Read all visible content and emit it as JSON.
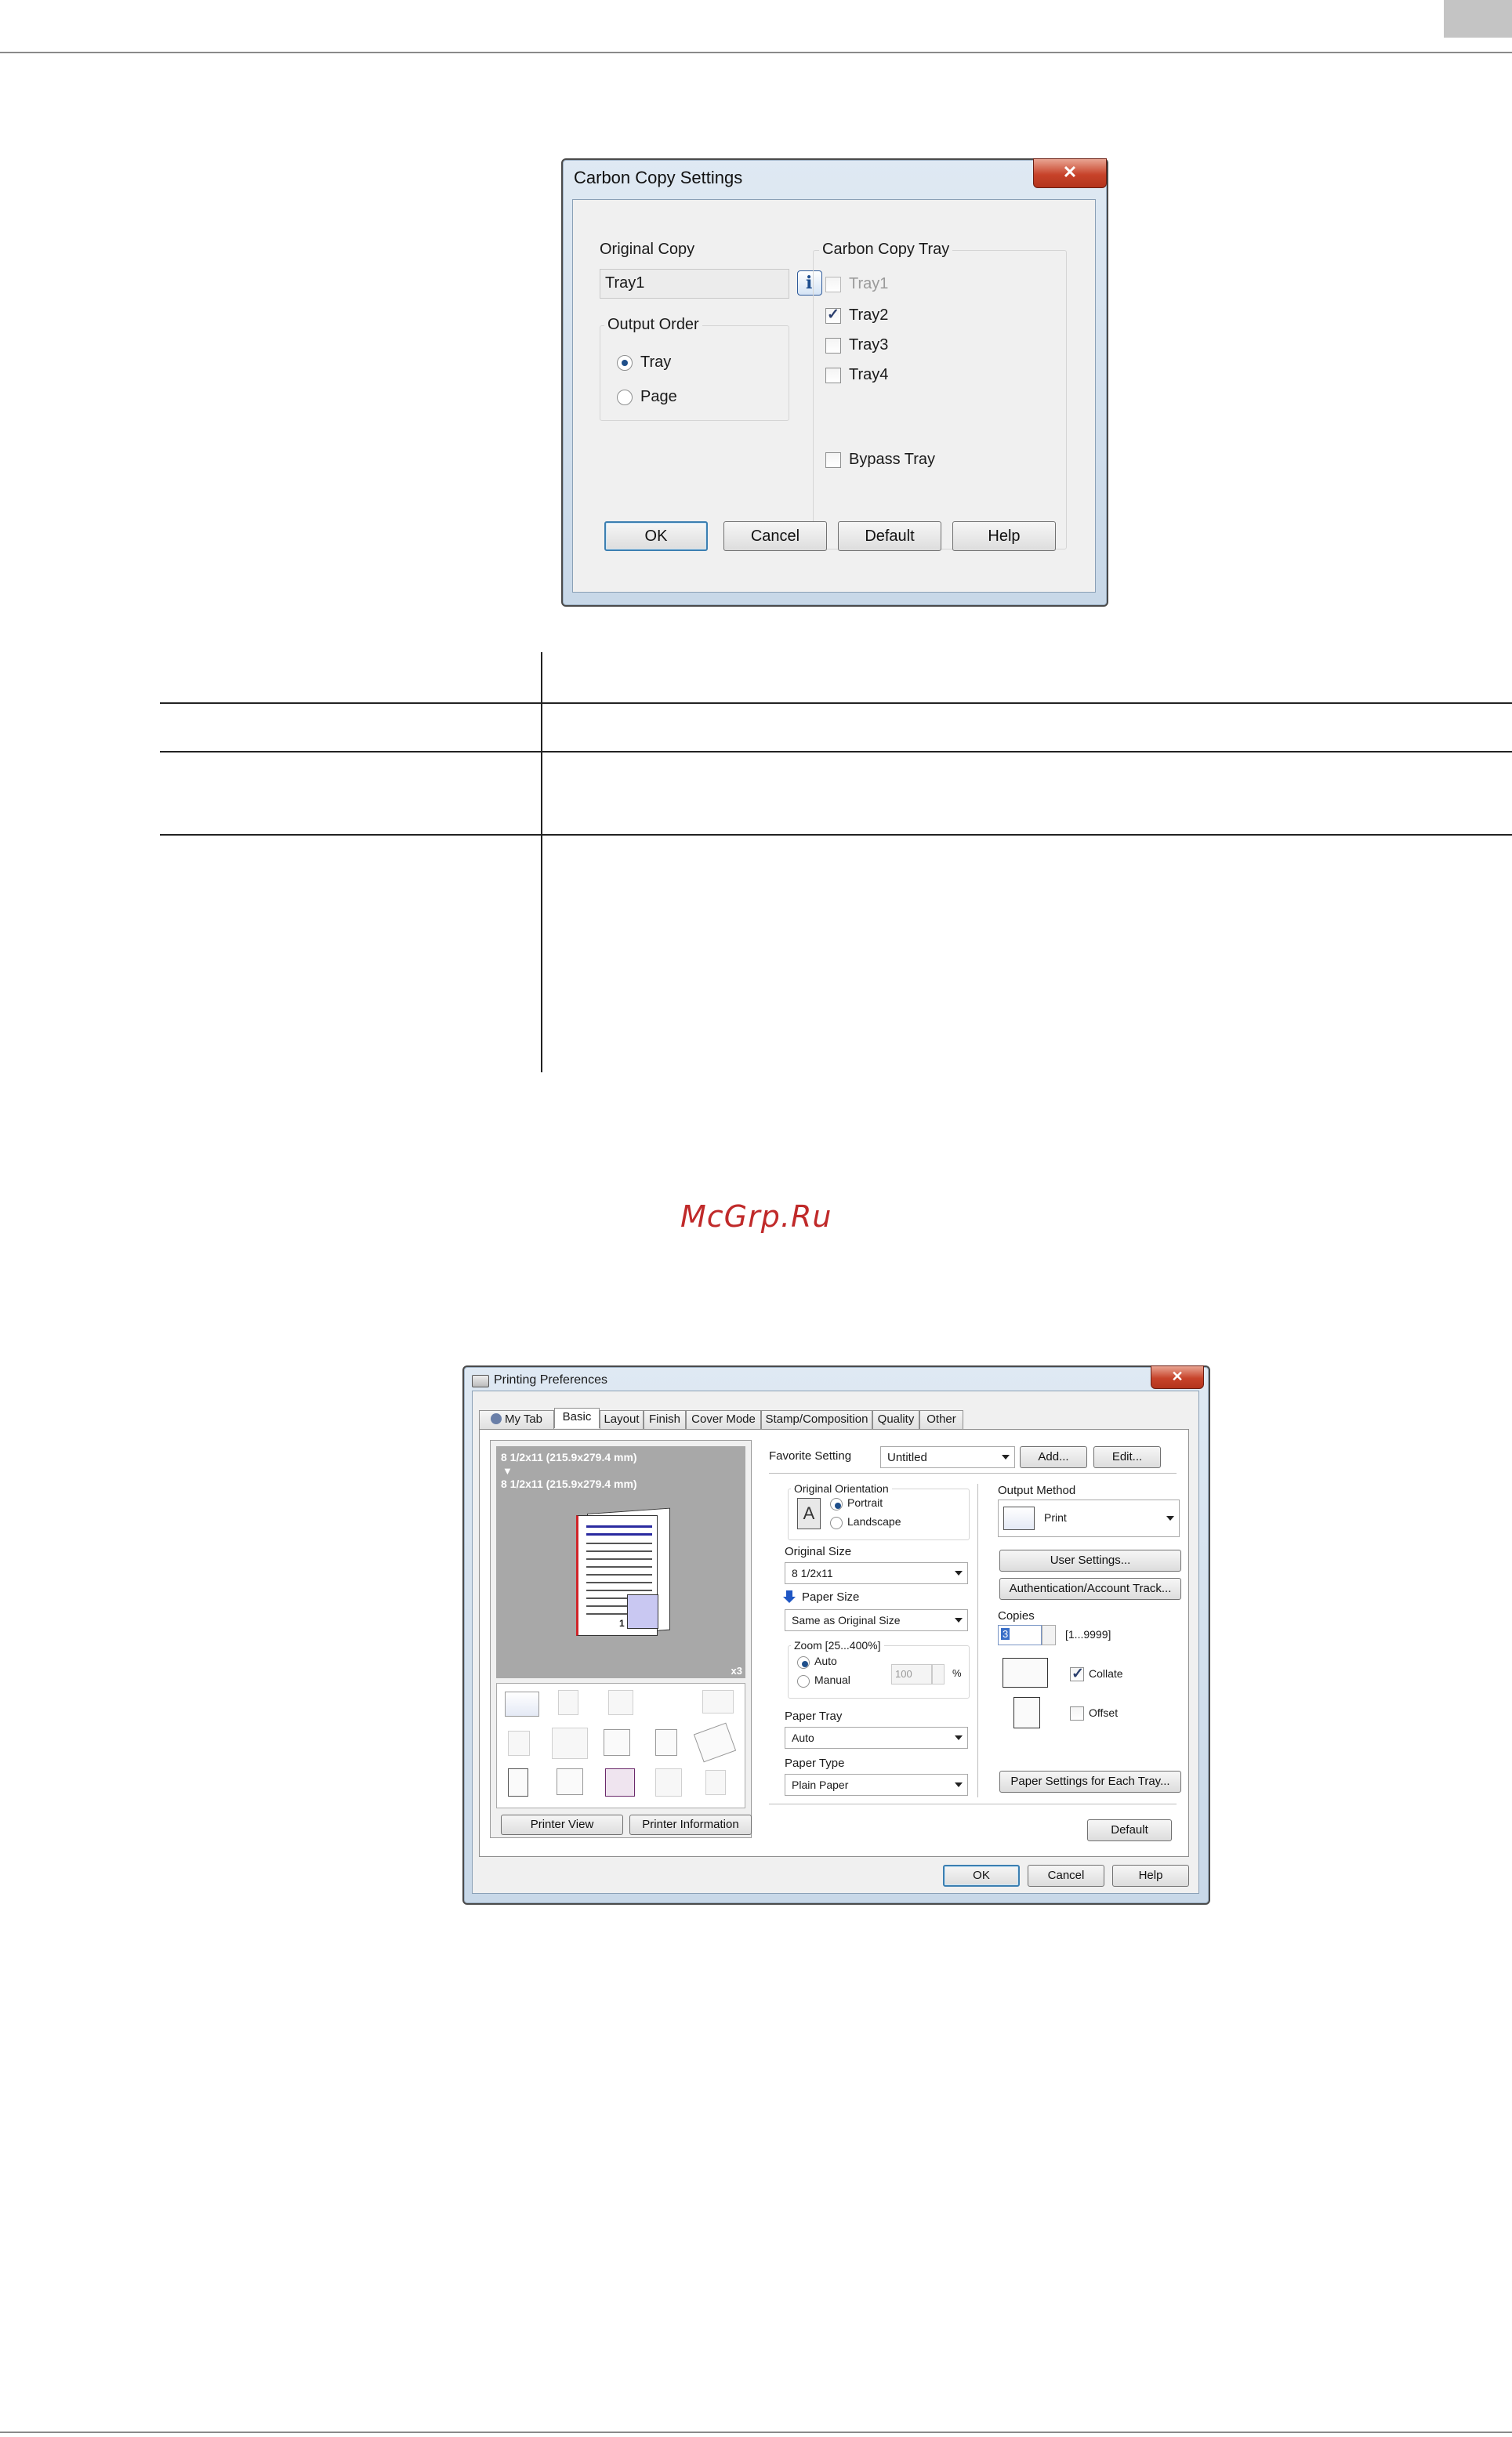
{
  "carbon_dialog": {
    "title": "Carbon Copy Settings",
    "close": "✕",
    "original_copy_label": "Original Copy",
    "original_copy_value": "Tray1",
    "info_glyph": "i",
    "output_order_label": "Output Order",
    "output_order_options": [
      "Tray",
      "Page"
    ],
    "carbon_copy_tray_label": "Carbon Copy Tray",
    "trays": [
      "Tray1",
      "Tray2",
      "Tray3",
      "Tray4"
    ],
    "bypass_tray": "Bypass Tray",
    "buttons": {
      "ok": "OK",
      "cancel": "Cancel",
      "default": "Default",
      "help": "Help"
    }
  },
  "watermark": "McGrp.Ru",
  "prefs_dialog": {
    "title": "Printing Preferences",
    "close": "✕",
    "tabs": [
      "My Tab",
      "Basic",
      "Layout",
      "Finish",
      "Cover Mode",
      "Stamp/Composition",
      "Quality",
      "Other"
    ],
    "preview": {
      "paper_line1": "8 1/2x11 (215.9x279.4 mm)",
      "arrow": "▼",
      "paper_line2": "8 1/2x11 (215.9x279.4 mm)",
      "page_number": "1",
      "copies_badge": "x3"
    },
    "printer_view_button": "Printer View",
    "printer_info_button": "Printer Information",
    "favorite_setting_label": "Favorite Setting",
    "favorite_setting_value": "Untitled",
    "add_button": "Add...",
    "edit_button": "Edit...",
    "original_orientation_label": "Original Orientation",
    "orientation_options": [
      "Portrait",
      "Landscape"
    ],
    "orientation_glyph": "A",
    "original_size_label": "Original Size",
    "original_size_value": "8 1/2x11",
    "paper_size_label": "Paper Size",
    "paper_size_value": "Same as Original Size",
    "zoom_label": "Zoom [25...400%]",
    "zoom_options": [
      "Auto",
      "Manual"
    ],
    "zoom_value": "100",
    "zoom_unit": "%",
    "paper_tray_label": "Paper Tray",
    "paper_tray_value": "Auto",
    "paper_type_label": "Paper Type",
    "paper_type_value": "Plain Paper",
    "output_method_label": "Output Method",
    "output_method_value": "Print",
    "user_settings_button": "User Settings...",
    "auth_button": "Authentication/Account Track...",
    "copies_label": "Copies",
    "copies_value": "3",
    "copies_range": "[1...9999]",
    "collate_label": "Collate",
    "offset_label": "Offset",
    "paper_settings_button": "Paper Settings for Each Tray...",
    "default_button": "Default",
    "ok_button": "OK",
    "cancel_button": "Cancel",
    "help_button": "Help"
  },
  "colors": {
    "title_bar": "#c8d8e8",
    "close_red": "#c7432a",
    "preview_gray": "#a8a8a8",
    "default_button_border": "#3c7fb1",
    "watermark": "#c02a2a"
  }
}
